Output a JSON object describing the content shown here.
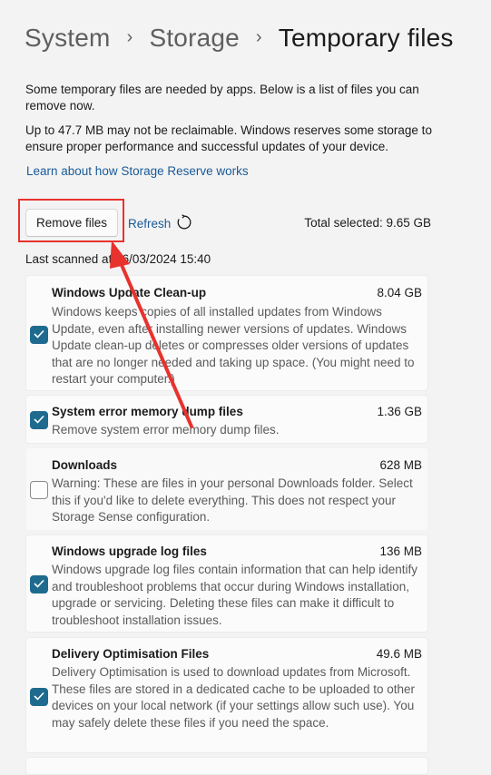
{
  "breadcrumb": {
    "items": [
      "System",
      "Storage"
    ],
    "current": "Temporary files",
    "separator": "›"
  },
  "intro": {
    "line1": "Some temporary files are needed by apps. Below is a list of files you can remove now.",
    "line2": "Up to 47.7 MB may not be reclaimable. Windows reserves some storage to ensure proper performance and successful updates of your device.",
    "link": "Learn about how Storage Reserve works"
  },
  "toolbar": {
    "remove_label": "Remove files",
    "refresh_label": "Refresh",
    "total_selected": "Total selected: 9.65 GB",
    "last_scanned": "Last scanned at 26/03/2024 15:40"
  },
  "items": [
    {
      "title": "Windows Update Clean-up",
      "size": "8.04 GB",
      "checked": true,
      "description": "Windows keeps copies of all installed updates from Windows Update, even after installing newer versions of updates. Windows Update clean-up deletes or compresses older versions of updates that are no longer needed and taking up space. (You might need to restart your computer.)"
    },
    {
      "title": "System error memory dump files",
      "size": "1.36 GB",
      "checked": true,
      "description": "Remove system error memory dump files."
    },
    {
      "title": "Downloads",
      "size": "628 MB",
      "checked": false,
      "description": "Warning: These are files in your personal Downloads folder. Select this if you'd like to delete everything. This does not respect your Storage Sense configuration."
    },
    {
      "title": "Windows upgrade log files",
      "size": "136 MB",
      "checked": true,
      "description": "Windows upgrade log files contain information that can help identify and troubleshoot problems that occur during Windows installation, upgrade or servicing. Deleting these files can make it difficult to troubleshoot installation issues."
    },
    {
      "title": "Delivery Optimisation Files",
      "size": "49.6 MB",
      "checked": true,
      "description": "Delivery Optimisation is used to download updates from Microsoft. These files are stored in a dedicated cache to be uploaded to other devices on your local network (if your settings allow such use). You may safely delete these files if you need the space."
    }
  ],
  "colors": {
    "accent": "#1f6b8f",
    "link": "#1a5a97",
    "annotation": "#e8322d"
  },
  "icons": [
    "chevron-right-icon",
    "refresh-icon",
    "checkmark-icon"
  ]
}
